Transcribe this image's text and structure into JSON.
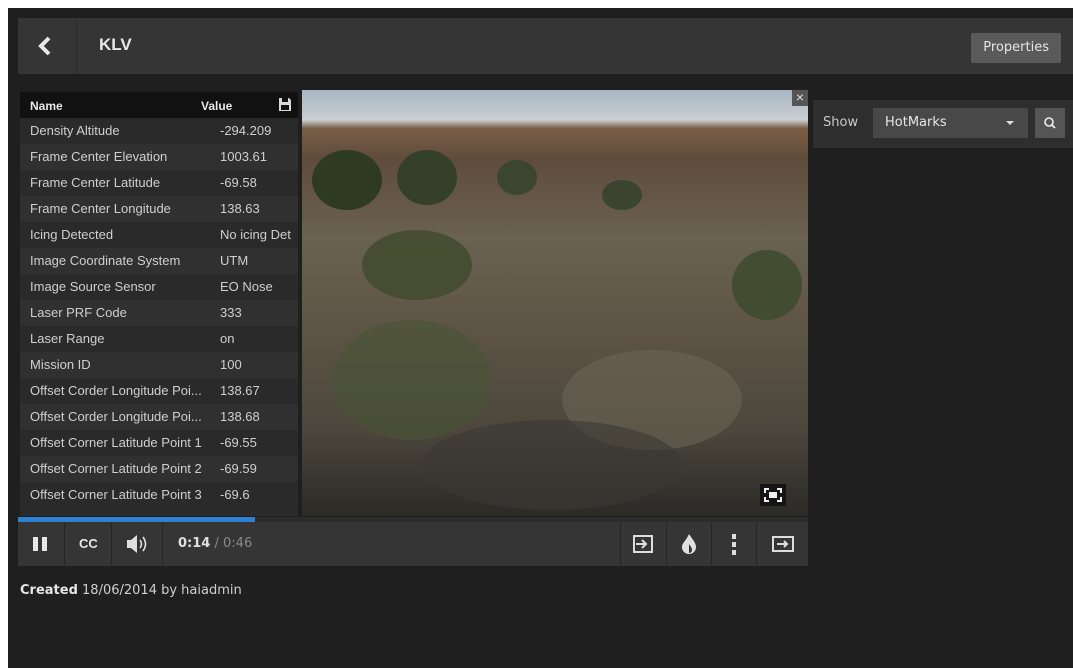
{
  "header": {
    "title": "KLV",
    "properties_label": "Properties"
  },
  "klv": {
    "col_name": "Name",
    "col_value": "Value",
    "rows": [
      {
        "name": "Density Altitude",
        "value": "-294.209"
      },
      {
        "name": "Frame Center Elevation",
        "value": "1003.61"
      },
      {
        "name": "Frame Center Latitude",
        "value": "-69.58"
      },
      {
        "name": "Frame Center Longitude",
        "value": "138.63"
      },
      {
        "name": "Icing Detected",
        "value": "No icing Det"
      },
      {
        "name": "Image Coordinate System",
        "value": "UTM"
      },
      {
        "name": "Image Source Sensor",
        "value": "EO Nose"
      },
      {
        "name": "Laser PRF Code",
        "value": "333"
      },
      {
        "name": "Laser Range",
        "value": "on"
      },
      {
        "name": "Mission ID",
        "value": "100"
      },
      {
        "name": "Offset Corder Longitude Poi...",
        "value": "138.67"
      },
      {
        "name": "Offset Corder Longitude Poi...",
        "value": "138.68"
      },
      {
        "name": "Offset Corner Latitude Point 1",
        "value": "-69.55"
      },
      {
        "name": "Offset Corner Latitude Point 2",
        "value": "-69.59"
      },
      {
        "name": "Offset Corner Latitude Point 3",
        "value": "-69.6"
      }
    ]
  },
  "player": {
    "progress_fraction": 0.3,
    "progress_color": "#2f80d1",
    "cc_label": "CC",
    "time_current": "0:14",
    "time_separator": "/",
    "time_duration": "0:46",
    "icons": [
      "pause-icon",
      "volume-icon",
      "export-icon",
      "hotmark-icon",
      "more-icon",
      "next-icon",
      "fullscreen-icon",
      "close-icon"
    ]
  },
  "created": {
    "label": "Created",
    "text": "18/06/2014 by haiadmin"
  },
  "panel": {
    "show_label": "Show",
    "filter_value": "HotMarks"
  }
}
